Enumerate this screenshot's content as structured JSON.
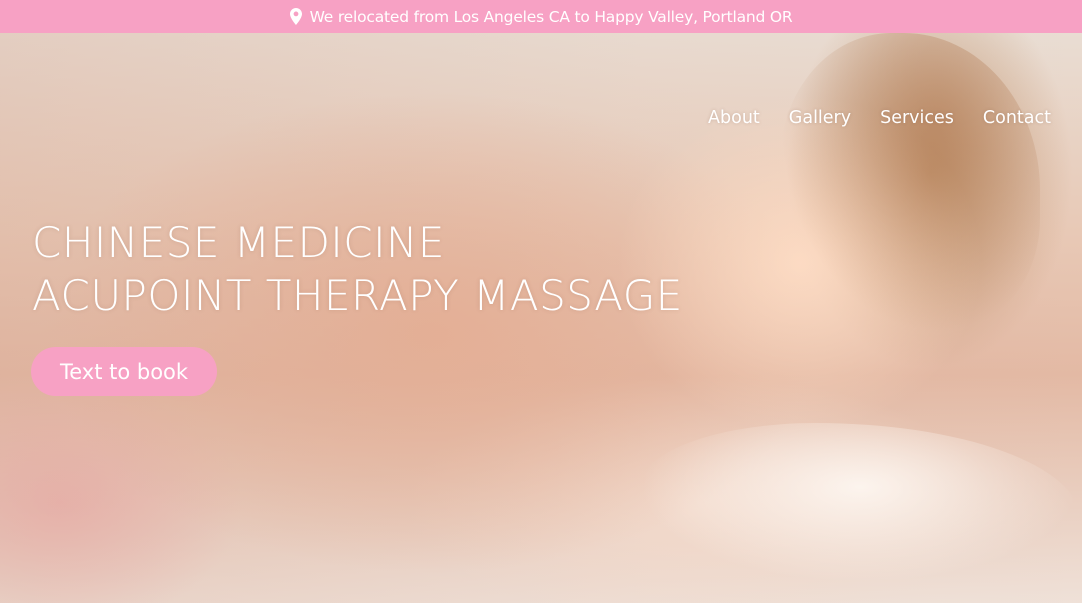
{
  "announcement": {
    "icon": "map-pin-icon",
    "text": "We relocated from Los Angeles CA to Happy Valley, Portland OR"
  },
  "nav": {
    "items": [
      {
        "label": "About"
      },
      {
        "label": "Gallery"
      },
      {
        "label": "Services"
      },
      {
        "label": "Contact"
      }
    ]
  },
  "hero": {
    "headline_line1": "CHINESE MEDICINE",
    "headline_line2": "ACUPOINT THERAPY MASSAGE",
    "cta_label": "Text to book"
  },
  "colors": {
    "accent_pink": "#f7a1c4",
    "text_white": "#ffffff"
  }
}
